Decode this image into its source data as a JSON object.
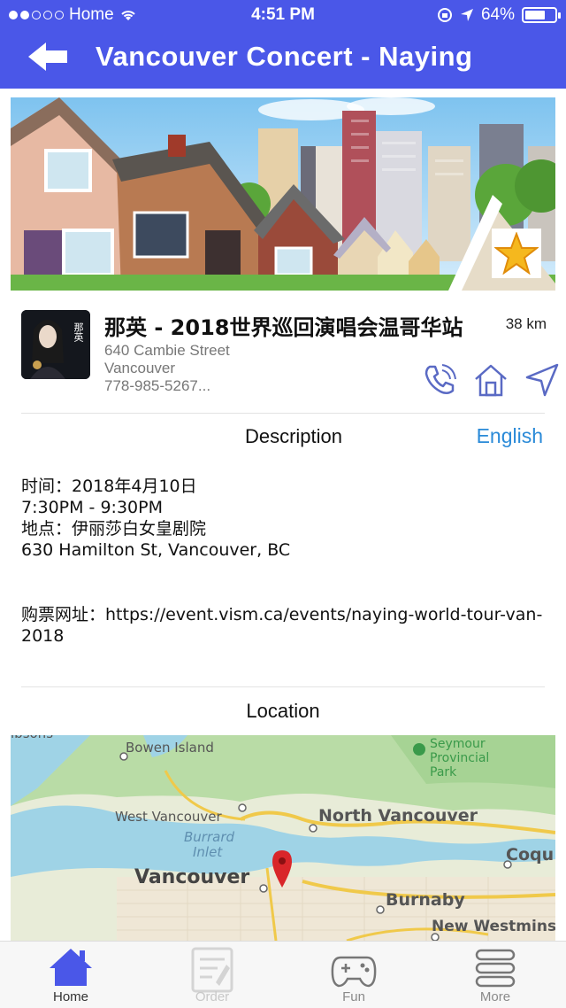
{
  "status": {
    "carrier": "Home",
    "time": "4:51 PM",
    "battery": "64%"
  },
  "nav": {
    "title": "Vancouver Concert - Naying",
    "back_icon": "arrow-left-icon"
  },
  "banner": {
    "favorite_icon": "star-icon"
  },
  "event": {
    "title": "那英 - 2018世界巡回演唱会温哥华站",
    "distance": "38 km",
    "address_line1": "640 Cambie Street",
    "address_line2": "Vancouver",
    "phone": "778-985-5267...",
    "thumb_text": "那英"
  },
  "description": {
    "heading": "Description",
    "language": "English",
    "body": "时间：2018年4月10日\n7:30PM - 9:30PM\n地点：伊丽莎白女皇剧院\n630 Hamilton St, Vancouver, BC",
    "ticket": "购票网址：https://event.vism.ca/events/naying-world-tour-van-2018"
  },
  "location": {
    "heading": "Location",
    "labels": {
      "top_left": "ibsons",
      "bowen": "Bowen Island",
      "seymour1": "Seymour",
      "seymour2": "Provincial",
      "seymour3": "Park",
      "west_van": "West Vancouver",
      "north_van": "North Vancouver",
      "burrard1": "Burrard",
      "burrard2": "Inlet",
      "vancouver": "Vancouver",
      "coquitlam": "Coqu",
      "burnaby": "Burnaby",
      "new_west": "New Westmins"
    }
  },
  "tabs": [
    {
      "label": "Home",
      "icon": "house-icon"
    },
    {
      "label": "Order",
      "icon": "document-icon"
    },
    {
      "label": "Fun",
      "icon": "gamepad-icon"
    },
    {
      "label": "More",
      "icon": "menu-icon"
    }
  ],
  "colors": {
    "nav": "#4a57e8",
    "accent": "#2a8ad8",
    "pin": "#d9262a"
  }
}
